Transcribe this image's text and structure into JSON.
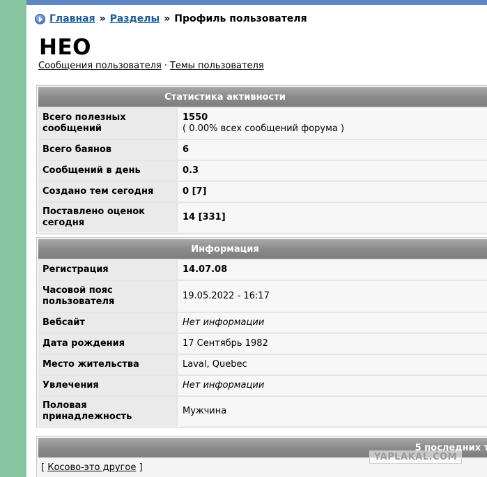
{
  "breadcrumb": {
    "home": "Главная",
    "sep1": "»",
    "sections": "Разделы",
    "sep2": "»",
    "current": "Профиль пользователя"
  },
  "profile": {
    "username": "HEO",
    "link_messages": "Сообщения пользователя",
    "dot": "·",
    "link_topics": "Темы пользователя"
  },
  "stats": {
    "header": "Статистика активности",
    "rows": [
      {
        "label": "Всего полезных сообщений",
        "value": "1550",
        "sub": "( 0.00% всех сообщений форума )"
      },
      {
        "label": "Всего баянов",
        "value": "6"
      },
      {
        "label": "Сообщений в день",
        "value": "0.3"
      },
      {
        "label": "Создано тем сегодня",
        "value": "0 [7]"
      },
      {
        "label": "Поставлено оценок сегодня",
        "value": "14 [331]"
      }
    ]
  },
  "info": {
    "header": "Информация",
    "rows": [
      {
        "label": "Регистрация",
        "value": "14.07.08"
      },
      {
        "label": "Часовой пояс пользователя",
        "value": "19.05.2022 - 16:17"
      },
      {
        "label": "Вебсайт",
        "value": "Нет информации"
      },
      {
        "label": "Дата рождения",
        "value": "17 Сентябрь 1982"
      },
      {
        "label": "Место жительства",
        "value": "Laval, Quebec"
      },
      {
        "label": "Увлечения",
        "value": "Нет информации"
      },
      {
        "label": "Половая принадлежность",
        "value": "Мужчина"
      }
    ]
  },
  "recent": {
    "header": "5 последних те",
    "bracket_open": "[",
    "item": "Косово-это другое",
    "bracket_close": "]"
  },
  "watermark": "YAPLAKAL.COM",
  "colors": {
    "left_bar": "#86c7a2",
    "top_bar": "#5f87c5",
    "link": "#1a5c96",
    "header_bg": "#8b8b8b"
  }
}
